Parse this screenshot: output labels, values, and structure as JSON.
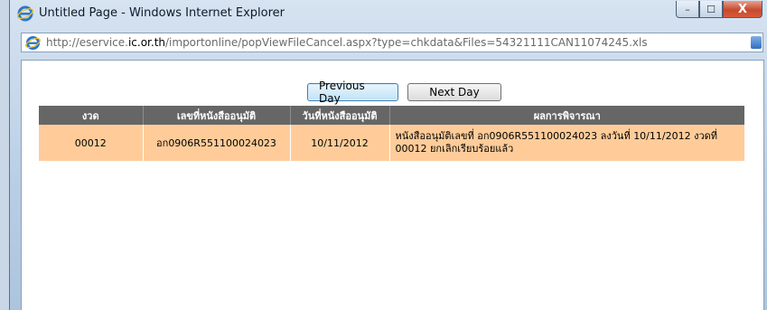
{
  "window": {
    "title": "Untitled Page - Windows Internet Explorer",
    "minimize_glyph": "–",
    "maximize_glyph": "☐",
    "close_glyph": "X"
  },
  "address": {
    "prefix": "http://eservice.",
    "domain": "ic.or.th",
    "rest": "/importonline/popViewFileCancel.aspx?type=chkdata&Files=54321111CAN11074245.xls"
  },
  "nav": {
    "previous_day": "Previous Day",
    "next_day": "Next Day"
  },
  "table": {
    "headers": [
      "งวด",
      "เลขที่หนังสืออนุมัติ",
      "วันที่หนังสืออนุมัติ",
      "ผลการพิจารณา"
    ],
    "rows": [
      [
        "00012",
        "อก0906R551100024023",
        "10/11/2012",
        "หนังสืออนุมัติเลขที่ อก0906R551100024023 ลงวันที่ 10/11/2012 งวดที่ 00012 ยกเลิกเรียบร้อยแล้ว"
      ]
    ]
  },
  "colors": {
    "header_bg": "#666666",
    "row_bg": "#ffcc99"
  },
  "icons": {
    "title": "ie-logo-icon",
    "address": "ie-logo-icon",
    "address_right": "picture-icon"
  }
}
